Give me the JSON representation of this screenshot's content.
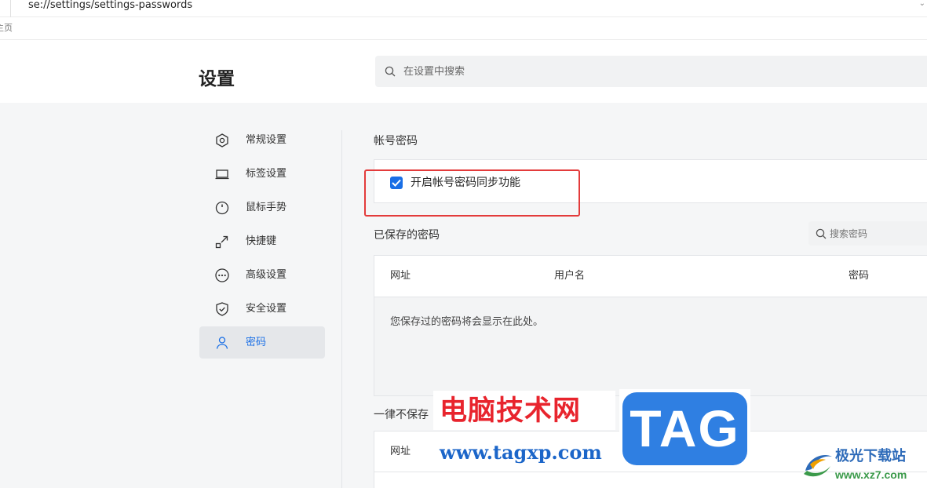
{
  "address_bar": {
    "url": "se://settings/settings-passwords"
  },
  "bookmarks_bar": {
    "item": "主页"
  },
  "header": {
    "title": "设置",
    "search_placeholder": "在设置中搜索"
  },
  "sidebar": {
    "items": [
      {
        "label": "常规设置",
        "icon": "hexagon-settings-icon",
        "active": false
      },
      {
        "label": "标签设置",
        "icon": "laptop-tab-icon",
        "active": false
      },
      {
        "label": "鼠标手势",
        "icon": "mouse-icon",
        "active": false
      },
      {
        "label": "快捷键",
        "icon": "shortcut-arrow-icon",
        "active": false
      },
      {
        "label": "高级设置",
        "icon": "more-circle-icon",
        "active": false
      },
      {
        "label": "安全设置",
        "icon": "shield-check-icon",
        "active": false
      },
      {
        "label": "密码",
        "icon": "user-icon",
        "active": true
      }
    ]
  },
  "account_password": {
    "title": "帐号密码",
    "sync_label": "开启帐号密码同步功能",
    "sync_checked": true
  },
  "saved_passwords": {
    "title": "已保存的密码",
    "search_placeholder": "搜索密码",
    "columns": [
      "网址",
      "用户名",
      "密码"
    ],
    "empty_message": "您保存过的密码将会显示在此处。"
  },
  "never_saved": {
    "title": "一律不保存",
    "columns": [
      "网址"
    ]
  },
  "watermarks": {
    "site_cn": "电脑技术网",
    "site_url": "www.tagxp.com",
    "tag": "TAG",
    "logo_name": "极光下载站",
    "logo_url": "www.xz7.com"
  },
  "colors": {
    "accent": "#1a6fe6",
    "highlight_box": "#e33b3b",
    "page_bg": "#f5f6f7"
  }
}
